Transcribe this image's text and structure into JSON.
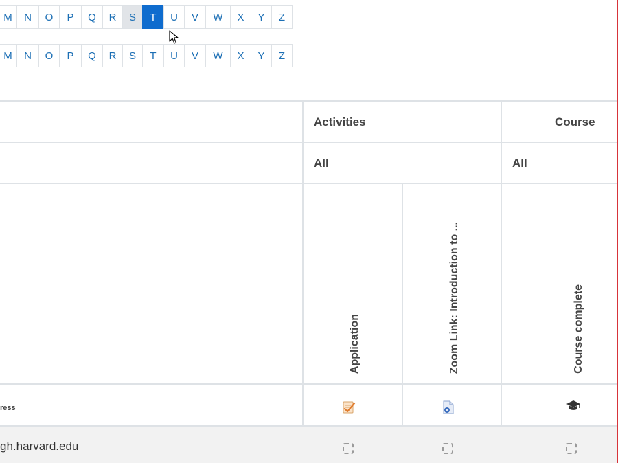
{
  "letter_bar_1": {
    "letters": [
      "M",
      "N",
      "O",
      "P",
      "Q",
      "R",
      "S",
      "T",
      "U",
      "V",
      "W",
      "X",
      "Y",
      "Z"
    ],
    "active": "T",
    "hover": "S"
  },
  "letter_bar_2": {
    "letters": [
      "M",
      "N",
      "O",
      "P",
      "Q",
      "R",
      "S",
      "T",
      "U",
      "V",
      "W",
      "X",
      "Y",
      "Z"
    ]
  },
  "table": {
    "group_headers": {
      "activities": "Activities",
      "course": "Course"
    },
    "filters": {
      "activities": "All",
      "course": "All"
    },
    "columns": [
      {
        "label": "Application",
        "icon": "assignment-icon"
      },
      {
        "label": "Zoom Link: Introduction to ...",
        "icon": "zoom-link-icon"
      },
      {
        "label": "Course complete",
        "icon": "graduation-cap-icon"
      }
    ],
    "icon_row_label": "ress",
    "rows": [
      {
        "email": "gh.harvard.edu"
      }
    ]
  },
  "colors": {
    "active_letter_bg": "#0f6cce",
    "link_color": "#1c6fb5",
    "border": "#dee2e6",
    "right_edge": "#d7343a"
  }
}
